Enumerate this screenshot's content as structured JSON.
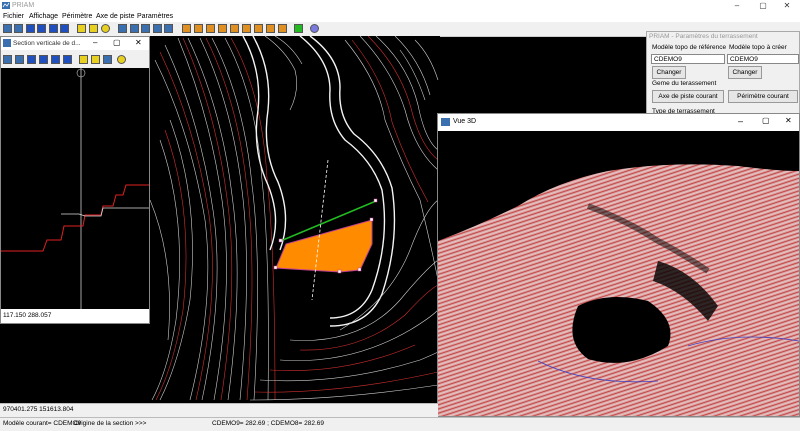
{
  "app": {
    "title": "PRIAM",
    "icon": "cad-app-icon"
  },
  "menu": [
    "Fichier",
    "Affichage",
    "Périmètre",
    "Axe de piste",
    "Paramètres"
  ],
  "toolbar_icons": [
    "new-file-icon",
    "open-file-icon",
    "save-icon",
    "print-icon",
    "tool-icon",
    "arrow-icon",
    "help-icon",
    "tool-icon",
    "pan-icon",
    "layer-icon",
    "layer-icon",
    "layer-icon",
    "layer-icon",
    "layer-icon",
    "layer-icon",
    "layer-icon",
    "layer-icon",
    "layer-icon",
    "green-grid-icon",
    "globe-icon"
  ],
  "section_window": {
    "title": "Section verticale de d...",
    "icons": [
      "new-file-icon",
      "open-file-icon",
      "save-icon",
      "print-icon",
      "tool-icon",
      "arrow-icon",
      "help-icon",
      "tool-icon",
      "pan-icon",
      "clock-icon"
    ],
    "coords": "117.150  288.057"
  },
  "params_panel": {
    "title": "PRIAM - Paramètres du terrassement",
    "ref_label": "Modèle topo de référence",
    "ref_value": "CDEMO9",
    "new_label": "Modèle topo à créer",
    "new_value": "CDEMO9",
    "change_label": "Changer",
    "geom_label": "Geme du terassement",
    "axe_button": "Axe de piste courant",
    "perim_button": "Périmètre courant",
    "type_label": "Type de terrassement"
  },
  "view3d": {
    "title": "Vue 3D"
  },
  "status": {
    "coords": "970401.275  151613.804",
    "model": "Modèle courant= CDEMO9",
    "origin": "Origine de la section >>>",
    "heights": "CDEMO9= 282.69 ; CDEMO8= 282.69"
  },
  "colors": {
    "platform": "#ff8c00",
    "contour_white": "#e8e8e8",
    "contour_red": "#d23030",
    "accent_green": "#22bb22"
  }
}
